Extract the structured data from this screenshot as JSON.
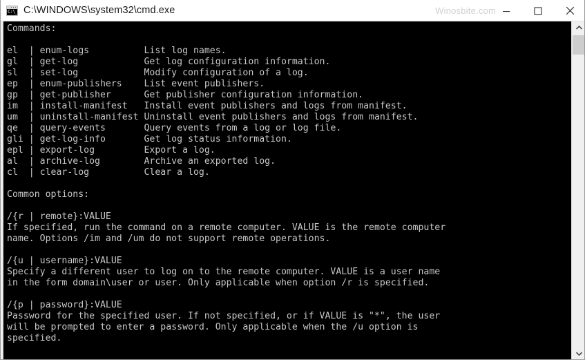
{
  "window": {
    "title": "C:\\WINDOWS\\system32\\cmd.exe",
    "icon_name": "cmd-console-icon",
    "icon_glyph": "C:\\_",
    "watermark": "Winosbite.com",
    "controls": {
      "minimize_label": "Minimize",
      "maximize_label": "Maximize",
      "close_label": "Close"
    }
  },
  "colors": {
    "console_background": "#000000",
    "console_foreground": "#c8c8c8",
    "titlebar_background": "#ffffff",
    "titlebar_foreground": "#1a1a1a",
    "watermark_color": "#d0d0d0",
    "scrollbar_track": "#f0f0f0",
    "scrollbar_thumb": "#cdcdcd",
    "window_border": "#9a9a9a"
  },
  "scrollbar": {
    "up_arrow": "scroll-up-arrow",
    "down_arrow": "scroll-down-arrow",
    "thumb": "scroll-thumb"
  },
  "console": {
    "headings": {
      "commands": "Commands:",
      "common_options": "Common options:"
    },
    "commands": [
      {
        "abbrev": "el",
        "name": "enum-logs",
        "description": "List log names."
      },
      {
        "abbrev": "gl",
        "name": "get-log",
        "description": "Get log configuration information."
      },
      {
        "abbrev": "sl",
        "name": "set-log",
        "description": "Modify configuration of a log."
      },
      {
        "abbrev": "ep",
        "name": "enum-publishers",
        "description": "List event publishers."
      },
      {
        "abbrev": "gp",
        "name": "get-publisher",
        "description": "Get publisher configuration information."
      },
      {
        "abbrev": "im",
        "name": "install-manifest",
        "description": "Install event publishers and logs from manifest."
      },
      {
        "abbrev": "um",
        "name": "uninstall-manifest",
        "description": "Uninstall event publishers and logs from manifest."
      },
      {
        "abbrev": "qe",
        "name": "query-events",
        "description": "Query events from a log or log file."
      },
      {
        "abbrev": "gli",
        "name": "get-log-info",
        "description": "Get log status information."
      },
      {
        "abbrev": "epl",
        "name": "export-log",
        "description": "Export a log."
      },
      {
        "abbrev": "al",
        "name": "archive-log",
        "description": "Archive an exported log."
      },
      {
        "abbrev": "cl",
        "name": "clear-log",
        "description": "Clear a log."
      }
    ],
    "options": [
      {
        "syntax": "/{r | remote}:VALUE",
        "lines": [
          "If specified, run the command on a remote computer. VALUE is the remote computer",
          "name. Options /im and /um do not support remote operations."
        ]
      },
      {
        "syntax": "/{u | username}:VALUE",
        "lines": [
          "Specify a different user to log on to the remote computer. VALUE is a user name",
          "in the form domain\\user or user. Only applicable when option /r is specified."
        ]
      },
      {
        "syntax": "/{p | password}:VALUE",
        "lines": [
          "Password for the specified user. If not specified, or if VALUE is \"*\", the user",
          "will be prompted to enter a password. Only applicable when the /u option is",
          "specified."
        ]
      }
    ],
    "full_text": "Commands:\n\nel  | enum-logs          List log names.\ngl  | get-log            Get log configuration information.\nsl  | set-log            Modify configuration of a log.\nep  | enum-publishers    List event publishers.\ngp  | get-publisher      Get publisher configuration information.\nim  | install-manifest   Install event publishers and logs from manifest.\num  | uninstall-manifest Uninstall event publishers and logs from manifest.\nqe  | query-events       Query events from a log or log file.\ngli | get-log-info       Get log status information.\nepl | export-log         Export a log.\nal  | archive-log        Archive an exported log.\ncl  | clear-log          Clear a log.\n\nCommon options:\n\n/{r | remote}:VALUE\nIf specified, run the command on a remote computer. VALUE is the remote computer\nname. Options /im and /um do not support remote operations.\n\n/{u | username}:VALUE\nSpecify a different user to log on to the remote computer. VALUE is a user name\nin the form domain\\user or user. Only applicable when option /r is specified.\n\n/{p | password}:VALUE\nPassword for the specified user. If not specified, or if VALUE is \"*\", the user\nwill be prompted to enter a password. Only applicable when the /u option is\nspecified."
  }
}
